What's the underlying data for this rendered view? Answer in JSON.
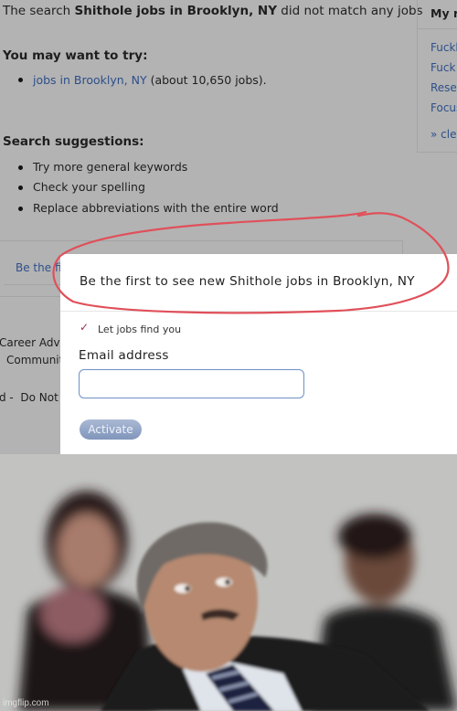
{
  "search": {
    "no_match_prefix": "The search ",
    "query": "Shithole jobs in Brooklyn, NY",
    "no_match_suffix": " did not match any jobs"
  },
  "try_section": {
    "heading": "You may want to try:",
    "items": [
      {
        "link": "jobs in Brooklyn, NY",
        "note": " (about 10,650 jobs)."
      }
    ]
  },
  "suggestions": {
    "heading": "Search suggestions:",
    "items": [
      "Try more general keywords",
      "Check your spelling",
      "Replace abbreviations with the entire word"
    ]
  },
  "recent_searches": {
    "title": "My re",
    "items": [
      "Fuckh",
      "Fuck y",
      "Resea",
      "Focus"
    ],
    "clear": "» clea"
  },
  "alert_teaser": "Be the fi",
  "footer": {
    "line1": "Career Advic",
    "line2": "Communit",
    "line3_prefix": "d -",
    "line3": "Do Not"
  },
  "modal": {
    "title": "Be the first to see new Shithole jobs in Brooklyn, NY",
    "checkbox_label": "Let jobs find you",
    "checkbox_checked": true,
    "email_label": "Email address",
    "email_value": "",
    "email_placeholder": "",
    "activate_label": "Activate"
  },
  "annotation": {
    "color": "#e0505a",
    "target": "modal-title"
  },
  "photo": {
    "description": "Meme reaction photo: man in suit and striped tie glancing sideways in a seated audience",
    "watermark": "imgflip.com"
  }
}
